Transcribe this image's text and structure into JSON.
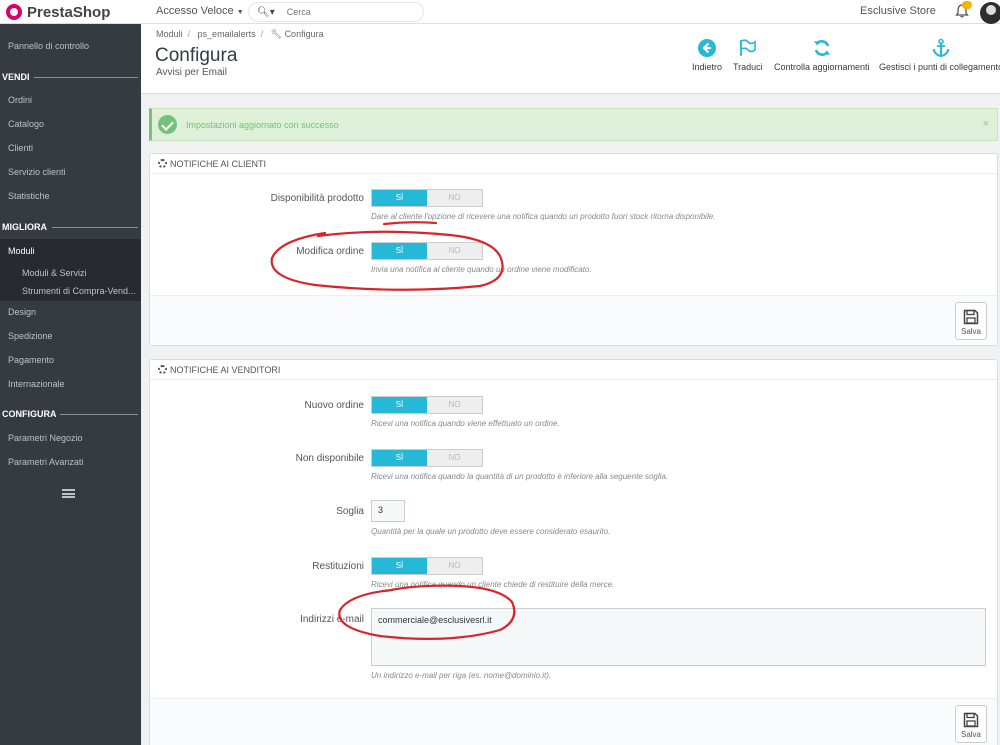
{
  "header": {
    "logo": "PrestaShop",
    "quick_access": "Accesso Veloce",
    "search_placeholder": "Cerca",
    "store_name": "Esclusive Store"
  },
  "sidebar": {
    "dashboard": "Pannello di controllo",
    "sections": {
      "vendi": "VENDI",
      "migliora": "MIGLIORA",
      "configura": "CONFIGURA"
    },
    "vendi_items": [
      "Ordini",
      "Catalogo",
      "Clienti",
      "Servizio clienti",
      "Statistiche"
    ],
    "migliora_items": [
      "Moduli",
      "Moduli & Servizi",
      "Strumenti di Compra-Vend...",
      "Design",
      "Spedizione",
      "Pagamento",
      "Internazionale"
    ],
    "configura_items": [
      "Parametri Negozio",
      "Parametri Avanzati"
    ]
  },
  "breadcrumb": [
    "Moduli",
    "ps_emailalerts",
    "Configura"
  ],
  "page": {
    "title": "Configura",
    "subtitle": "Avvisi per Email"
  },
  "toolbar": {
    "back": "Indietro",
    "translate": "Traduci",
    "check_updates": "Controlla aggiornamenti",
    "hooks": "Gestisci i punti di collegamento"
  },
  "alert": {
    "message": "Impostazioni aggiornato con successo",
    "close": "×"
  },
  "colors": {
    "accent": "#25b9d7",
    "success": "#72c279",
    "sidebar": "#363a41",
    "annotation": "#d9232d"
  },
  "customer_panel": {
    "title": "NOTIFICHE AI CLIENTI",
    "rows": [
      {
        "label": "Disponibilità prodotto",
        "on": "SÌ",
        "off": "NO",
        "help": "Dare al cliente l'opzione di ricevere una notifica quando un prodotto fuori stock ritorna disponibile."
      },
      {
        "label": "Modifica ordine",
        "on": "SÌ",
        "off": "NO",
        "help": "Invia una notifica al cliente quando un ordine viene modificato."
      }
    ],
    "save": "Salva"
  },
  "merchant_panel": {
    "title": "NOTIFICHE AI VENDITORI",
    "rows": [
      {
        "label": "Nuovo ordine",
        "on": "SÌ",
        "off": "NO",
        "help": "Ricevi una notifica quando viene effettuato un ordine."
      },
      {
        "label": "Non disponibile",
        "on": "SÌ",
        "off": "NO",
        "help": "Ricevi una notifica quando la quantità di un prodotto è inferiore alla seguente soglia."
      },
      {
        "label": "Soglia",
        "value": "3",
        "help": "Quantità per la quale un prodotto deve essere considerato esaurito."
      },
      {
        "label": "Restituzioni",
        "on": "SÌ",
        "off": "NO",
        "help": "Ricevi una notifica quando un cliente chiede di restituire della merce."
      },
      {
        "label": "Indirizzi e-mail",
        "value": "commerciale@esclusivesrl.it",
        "help": "Un indirizzo e-mail per riga (es. nome@dominio.it)."
      }
    ],
    "save": "Salva"
  }
}
